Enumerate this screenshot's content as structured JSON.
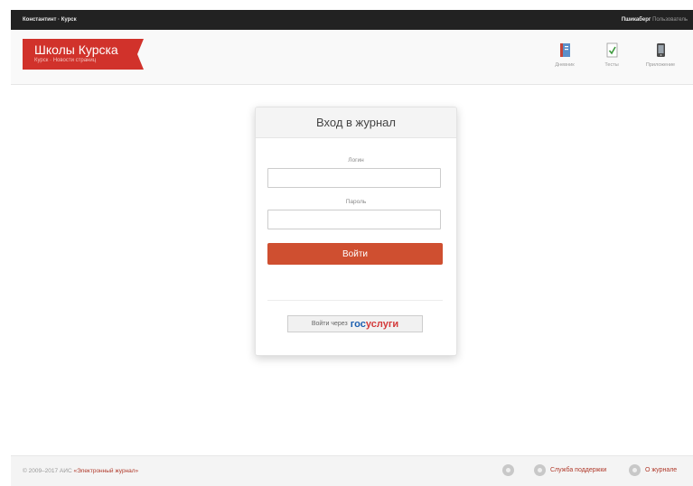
{
  "topbar": {
    "brand": "Константинт · Курск",
    "user_name": "Пшикаберг",
    "user_role": "Пользователь"
  },
  "header": {
    "logo_title": "Школы Курска",
    "logo_subtitle": "Курск · Новости страниц",
    "nav": [
      {
        "label": "Дневник",
        "icon": "book-icon"
      },
      {
        "label": "Тесты",
        "icon": "checklist-icon"
      },
      {
        "label": "Приложение",
        "icon": "phone-icon"
      }
    ]
  },
  "login": {
    "title": "Вход в журнал",
    "login_label": "Логин",
    "login_value": "",
    "password_label": "Пароль",
    "password_value": "",
    "submit_label": "Войти",
    "gosuslugi_prefix": "Войти через",
    "gosuslugi_part1": "гос",
    "gosuslugi_part2": "услуги"
  },
  "footer": {
    "copyright": "© 2009–2017 АИС",
    "copyright_link": "«Электронный журнал»",
    "links": [
      {
        "label": "",
        "icon": "phone-icon"
      },
      {
        "label": "Служба поддержки",
        "icon": "support-icon"
      },
      {
        "label": "О журнале",
        "icon": "info-icon"
      }
    ]
  },
  "colors": {
    "topbar": "#222222",
    "brand_red": "#d1322b",
    "submit_button": "#cf4f30",
    "gos_blue": "#1c5fb0",
    "gos_red": "#d43a3a"
  }
}
